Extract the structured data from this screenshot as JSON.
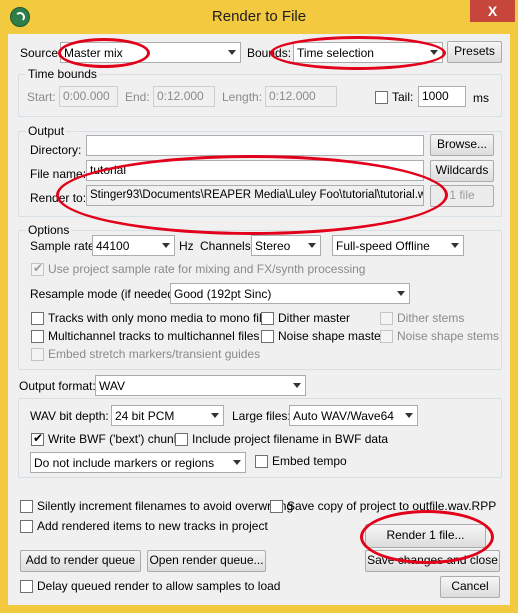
{
  "window": {
    "title": "Render to File",
    "close": "X"
  },
  "colors": {
    "title_bar": "#f3c93f",
    "annotation_red": "#e2001a",
    "close_red": "#c7463c"
  },
  "source": {
    "label": "Source:",
    "value": "Master mix"
  },
  "bounds": {
    "label": "Bounds:",
    "value": "Time selection"
  },
  "presets_label": "Presets",
  "time_bounds": {
    "title": "Time bounds",
    "start_label": "Start:",
    "start": "0:00.000",
    "end_label": "End:",
    "end": "0:12.000",
    "length_label": "Length:",
    "length": "0:12.000",
    "tail_label": "Tail:",
    "tail_checked": false,
    "tail_value": "1000",
    "tail_unit": "ms"
  },
  "output": {
    "title": "Output",
    "directory_label": "Directory:",
    "directory_value": "",
    "browse": "Browse...",
    "filename_label": "File name:",
    "filename_value": "tutorial",
    "wildcards": "Wildcards",
    "render_to_label": "Render to:",
    "render_to_value": "Stinger93\\Documents\\REAPER Media\\Luley Foo\\tutorial\\tutorial.wav",
    "file_count": "1 file"
  },
  "options": {
    "title": "Options",
    "sample_rate_label": "Sample rate:",
    "sample_rate": "44100",
    "hz": "Hz",
    "channels_label": "Channels:",
    "channels": "Stereo",
    "speed": "Full-speed Offline",
    "use_project_rate": "Use project sample rate for mixing and FX/synth processing",
    "resample_label": "Resample mode (if needed):",
    "resample": "Good (192pt Sinc)",
    "mono_tracks": "Tracks with only mono media to mono file",
    "dither_master": "Dither master",
    "dither_stems": "Dither stems",
    "multichannel": "Multichannel tracks to multichannel files",
    "noise_master": "Noise shape master",
    "noise_stems": "Noise shape stems",
    "embed_stretch": "Embed stretch markers/transient guides"
  },
  "format": {
    "label": "Output format:",
    "value": "WAV",
    "bit_depth_label": "WAV bit depth:",
    "bit_depth": "24 bit PCM",
    "large_files_label": "Large files:",
    "large_files": "Auto WAV/Wave64",
    "bwf": "Write BWF ('bext') chunk",
    "bwf_checked": true,
    "include_name": "Include project filename in BWF data",
    "markers": "Do not include markers or regions",
    "embed_tempo": "Embed tempo"
  },
  "bottom": {
    "silently_increment": "Silently increment filenames to avoid overwriting",
    "save_copy": "Save copy of project to outfile.wav.RPP",
    "add_rendered": "Add rendered items to new tracks in project",
    "render_button": "Render 1 file...",
    "add_queue": "Add to render queue",
    "open_queue": "Open render queue...",
    "save_close": "Save changes and close",
    "delay_queued": "Delay queued render to allow samples to load",
    "cancel": "Cancel"
  }
}
